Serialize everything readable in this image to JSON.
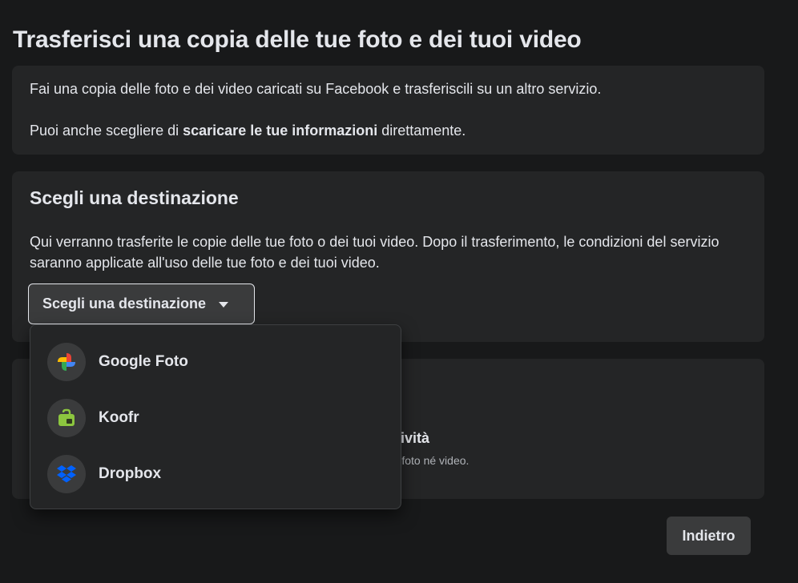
{
  "page": {
    "title": "Trasferisci una copia delle tue foto e dei tuoi video"
  },
  "intro": {
    "line1": "Fai una copia delle foto e dei video caricati su Facebook e trasferiscili su un altro servizio.",
    "line2_prefix": "Puoi anche scegliere di ",
    "line2_link": "scaricare le tue informazioni",
    "line2_suffix": " direttamente."
  },
  "destination": {
    "title": "Scegli una destinazione",
    "description": "Qui verranno trasferite le copie delle tue foto o dei tuoi video. Dopo il trasferimento, le condizioni del servizio saranno applicate all'uso delle tue foto e dei tuoi video.",
    "select_label": "Scegli una destinazione",
    "options": [
      {
        "label": "Google Foto",
        "icon": "google-photos-icon"
      },
      {
        "label": "Koofr",
        "icon": "koofr-icon"
      },
      {
        "label": "Dropbox",
        "icon": "dropbox-icon"
      }
    ]
  },
  "activity": {
    "title_fragment": "attività",
    "subtitle_fragment": "rito foto né video."
  },
  "footer": {
    "back_label": "Indietro"
  },
  "colors": {
    "background": "#18191a",
    "card": "#242526",
    "button": "#3a3b3c",
    "text": "#e4e6eb",
    "secondary_text": "#b0b3b8",
    "koofr_green": "#8cc63f",
    "dropbox_blue": "#0061fe"
  }
}
